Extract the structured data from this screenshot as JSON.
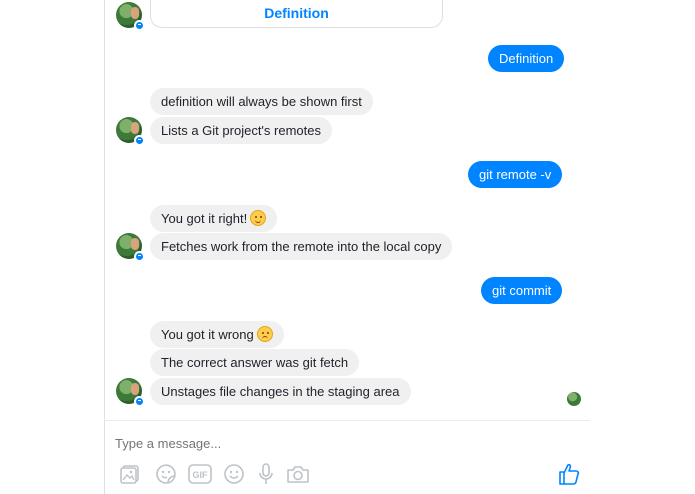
{
  "conversation": {
    "top_card": {
      "button_label": "Definition"
    },
    "messages": [
      {
        "side": "right",
        "text": "Definition"
      },
      {
        "side": "left",
        "text": "definition will always be shown first"
      },
      {
        "side": "left",
        "text": "Lists a Git project's remotes"
      },
      {
        "side": "right",
        "text": "git remote -v"
      },
      {
        "side": "left",
        "text": "You got it right!"
      },
      {
        "side": "left",
        "text": "Fetches work from the remote into the local copy"
      },
      {
        "side": "right",
        "text": "git commit"
      },
      {
        "side": "left",
        "text": "You got it wrong"
      },
      {
        "side": "left",
        "text": "The correct answer was git fetch"
      },
      {
        "side": "left",
        "text": "Unstages file changes in the staging area"
      }
    ]
  },
  "composer": {
    "placeholder": "Type a message...",
    "icons": [
      "image-icon",
      "sticker-icon",
      "gif-icon",
      "emoji-icon",
      "microphone-icon",
      "camera-icon",
      "like-icon"
    ]
  },
  "colors": {
    "accent": "#0084ff",
    "bubble_gray": "#f1f0f0",
    "icon_gray": "#bec3c9"
  }
}
